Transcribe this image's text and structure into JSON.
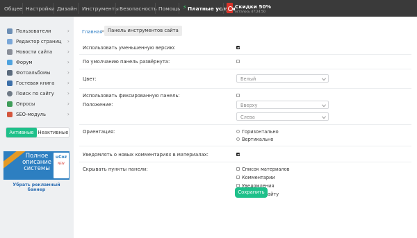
{
  "topnav": {
    "items": [
      "Общее",
      "Настройки",
      "Дизайн",
      "Инструменты",
      "Безопасность",
      "Помощь"
    ],
    "paid_services": "Платные услуги",
    "promo_title": "Скидки 50%",
    "promo_subtitle": "осталось 47:24:50"
  },
  "sidebar": {
    "items": [
      {
        "label": "Пользователи",
        "icon": "users-icon"
      },
      {
        "label": "Редактор страниц",
        "icon": "pages-editor-icon"
      },
      {
        "label": "Новости сайта",
        "icon": "news-icon"
      },
      {
        "label": "Форум",
        "icon": "forum-icon"
      },
      {
        "label": "Фотоальбомы",
        "icon": "photo-album-icon"
      },
      {
        "label": "Гостевая книга",
        "icon": "guestbook-icon"
      },
      {
        "label": "Поиск по сайту",
        "icon": "search-icon"
      },
      {
        "label": "Опросы",
        "icon": "polls-icon"
      },
      {
        "label": "SEO-модуль",
        "icon": "seo-icon"
      }
    ],
    "toggle_active": "Активные",
    "toggle_inactive": "Неактивные",
    "remove_ad": "Убрать рекламный баннер"
  },
  "banner": {
    "text": "Полное описание системы",
    "logo": "uCoz",
    "tag": "NEW"
  },
  "breadcrumb": {
    "home": "Главная",
    "separator": "»",
    "current": "Панель инструментов сайта"
  },
  "form": {
    "use_small_version": {
      "label": "Использовать уменьшенную версию:",
      "checked": true
    },
    "expanded_default": {
      "label": "По умолчанию панель развёрнута:",
      "checked": false
    },
    "color": {
      "label": "Цвет:",
      "value": "Белый"
    },
    "use_fixed": {
      "label": "Использовать фиксированную панель:",
      "checked": false
    },
    "position": {
      "label": "Положение:",
      "vertical": "Вверху",
      "horizontal": "Слева"
    },
    "orientation": {
      "label": "Ориентация:",
      "options": [
        "Горизонтально",
        "Вертикально"
      ],
      "selected": null
    },
    "notify": {
      "label": "Уведомлять о новых комментариях в материалах:",
      "checked": true
    },
    "hide_items": {
      "label": "Скрывать пункты панели:",
      "options": [
        "Список материалов",
        "Комментарии",
        "Уведомления",
        "Поиск по сайту"
      ]
    },
    "save_label": "Сохранить"
  },
  "colors": {
    "topbar": "#3a3a3a",
    "accent_green": "#1ec08a",
    "link_blue": "#2f7fc5",
    "promo_red": "#d8332a"
  }
}
